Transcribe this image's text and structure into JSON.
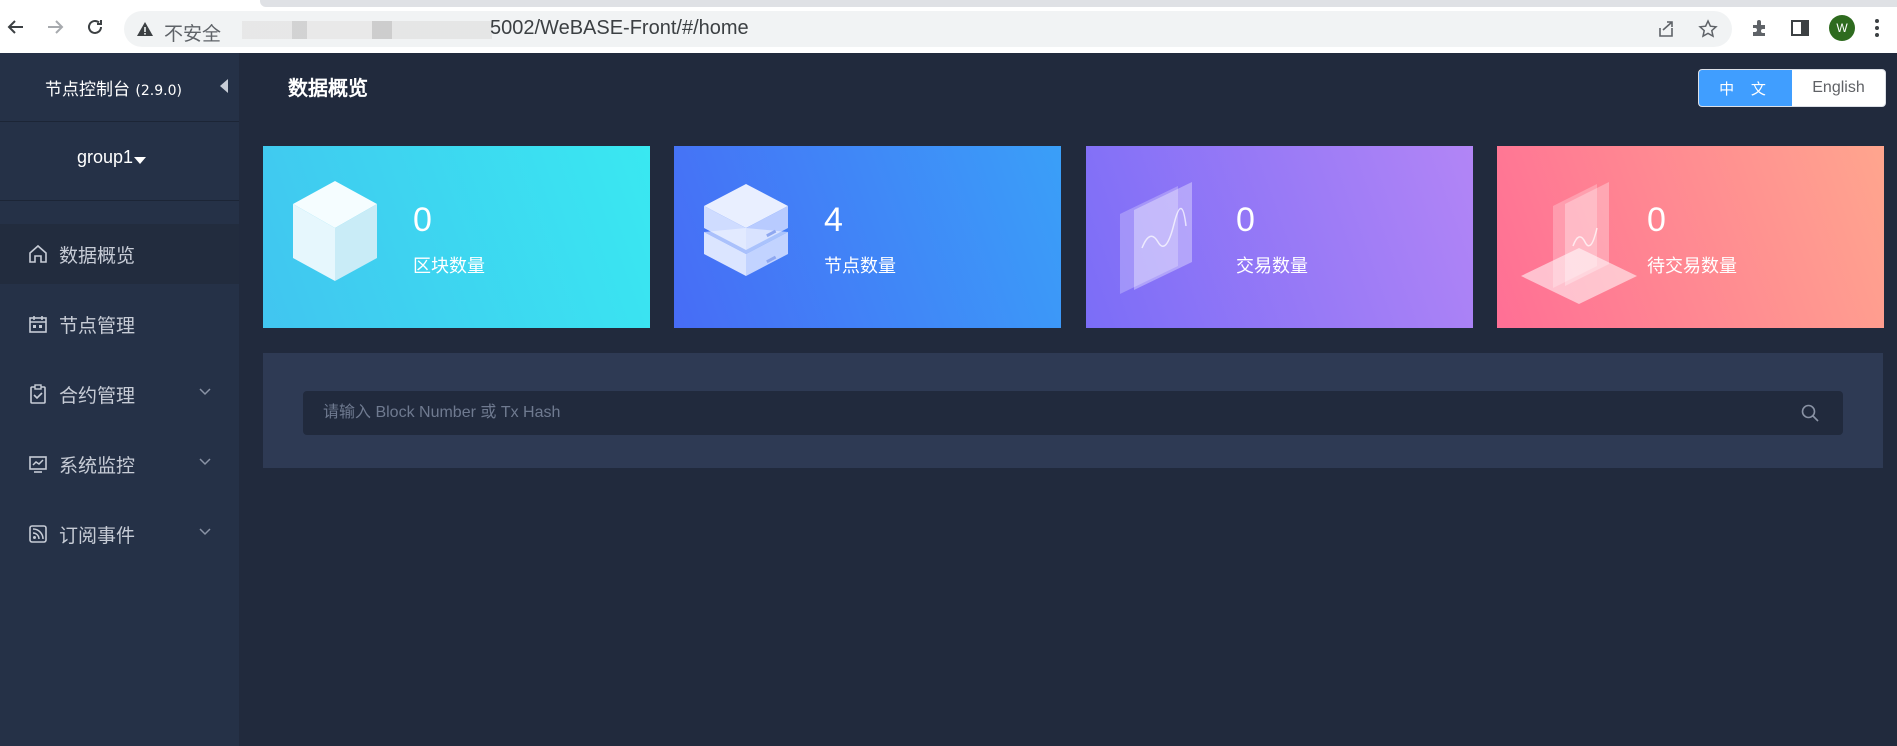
{
  "browser": {
    "insecure_label": "不安全",
    "url": "5002/WeBASE-Front/#/home",
    "avatar_initial": "W"
  },
  "sidebar": {
    "brand_title": "节点控制台",
    "brand_version": "(2.9.0)",
    "group": "group1",
    "items": [
      {
        "label": "数据概览",
        "icon": "home-icon",
        "expandable": false
      },
      {
        "label": "节点管理",
        "icon": "calendar-icon",
        "expandable": false
      },
      {
        "label": "合约管理",
        "icon": "clipboard-check-icon",
        "expandable": true
      },
      {
        "label": "系统监控",
        "icon": "monitor-chart-icon",
        "expandable": true
      },
      {
        "label": "订阅事件",
        "icon": "rss-icon",
        "expandable": true
      }
    ]
  },
  "header": {
    "title": "数据概览",
    "lang_zh": "中 文",
    "lang_en": "English",
    "active_lang": "zh"
  },
  "stats": [
    {
      "value": "0",
      "label": "区块数量",
      "icon": "cube-icon"
    },
    {
      "value": "4",
      "label": "节点数量",
      "icon": "server-icon"
    },
    {
      "value": "0",
      "label": "交易数量",
      "icon": "chart-panel-icon"
    },
    {
      "value": "0",
      "label": "待交易数量",
      "icon": "laptop-icon"
    }
  ],
  "search": {
    "placeholder": "请输入 Block Number 或 Tx Hash"
  },
  "colors": {
    "background": "#212a3d",
    "sidebar": "#253147",
    "accent": "#409eff"
  }
}
